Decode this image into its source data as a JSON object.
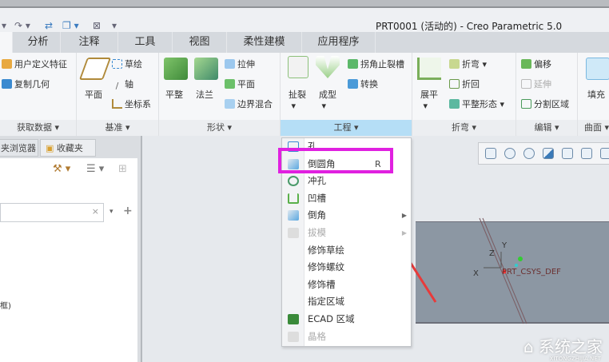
{
  "window": {
    "title": "PRT0001 (活动的) - Creo Parametric 5.0"
  },
  "tabs": [
    "分析",
    "注释",
    "工具",
    "视图",
    "柔性建模",
    "应用程序"
  ],
  "ribbon": {
    "get_data": {
      "label": "获取数据 ▾",
      "items": [
        "用户定义特征",
        "复制几何"
      ]
    },
    "datum": {
      "label": "基准 ▾",
      "plane": "平面",
      "items": [
        "草绘",
        "轴",
        "坐标系"
      ]
    },
    "shapes": {
      "label": "形状 ▾",
      "flat": "平整",
      "flange": "法兰",
      "items": [
        "拉伸",
        "平面",
        "边界混合"
      ]
    },
    "engineering": {
      "label": "工程 ▾",
      "rip": "扯裂",
      "form": "成型",
      "items": [
        "拐角止裂槽",
        "转换"
      ]
    },
    "bend": {
      "label": "折弯 ▾",
      "unbend": "展平",
      "items": [
        "折弯 ▾",
        "折回",
        "平整形态 ▾"
      ]
    },
    "edit": {
      "label": "编辑 ▾",
      "items": [
        "偏移",
        "延伸",
        "分割区域"
      ]
    },
    "surface": {
      "label": "曲面 ▾",
      "fill": "填充"
    }
  },
  "left_panel": {
    "tabs": [
      "夹浏览器",
      "收藏夹"
    ],
    "tree_text": "框)"
  },
  "menu": {
    "items": [
      {
        "label": "孔"
      },
      {
        "label": "倒圆角",
        "shortcut": "R"
      },
      {
        "label": "冲孔"
      },
      {
        "label": "凹槽"
      },
      {
        "label": "倒角",
        "submenu": true
      },
      {
        "label": "拔模",
        "disabled": true,
        "submenu": true
      },
      {
        "label": "修饰草绘"
      },
      {
        "label": "修饰螺纹"
      },
      {
        "label": "修饰槽"
      },
      {
        "label": "指定区域"
      },
      {
        "label": "ECAD 区域"
      },
      {
        "label": "晶格",
        "disabled": true
      }
    ]
  },
  "model": {
    "csys_label": "PRT_CSYS_DEF",
    "axis_x": "X",
    "axis_y": "Y",
    "axis_z": "Z"
  },
  "watermark": {
    "text": "系统之家",
    "url": "XITONGZHIJIA.NET"
  },
  "colors": {
    "highlight": "#e020e0",
    "arrow": "#e83a3a",
    "active_group": "#b5def6"
  }
}
